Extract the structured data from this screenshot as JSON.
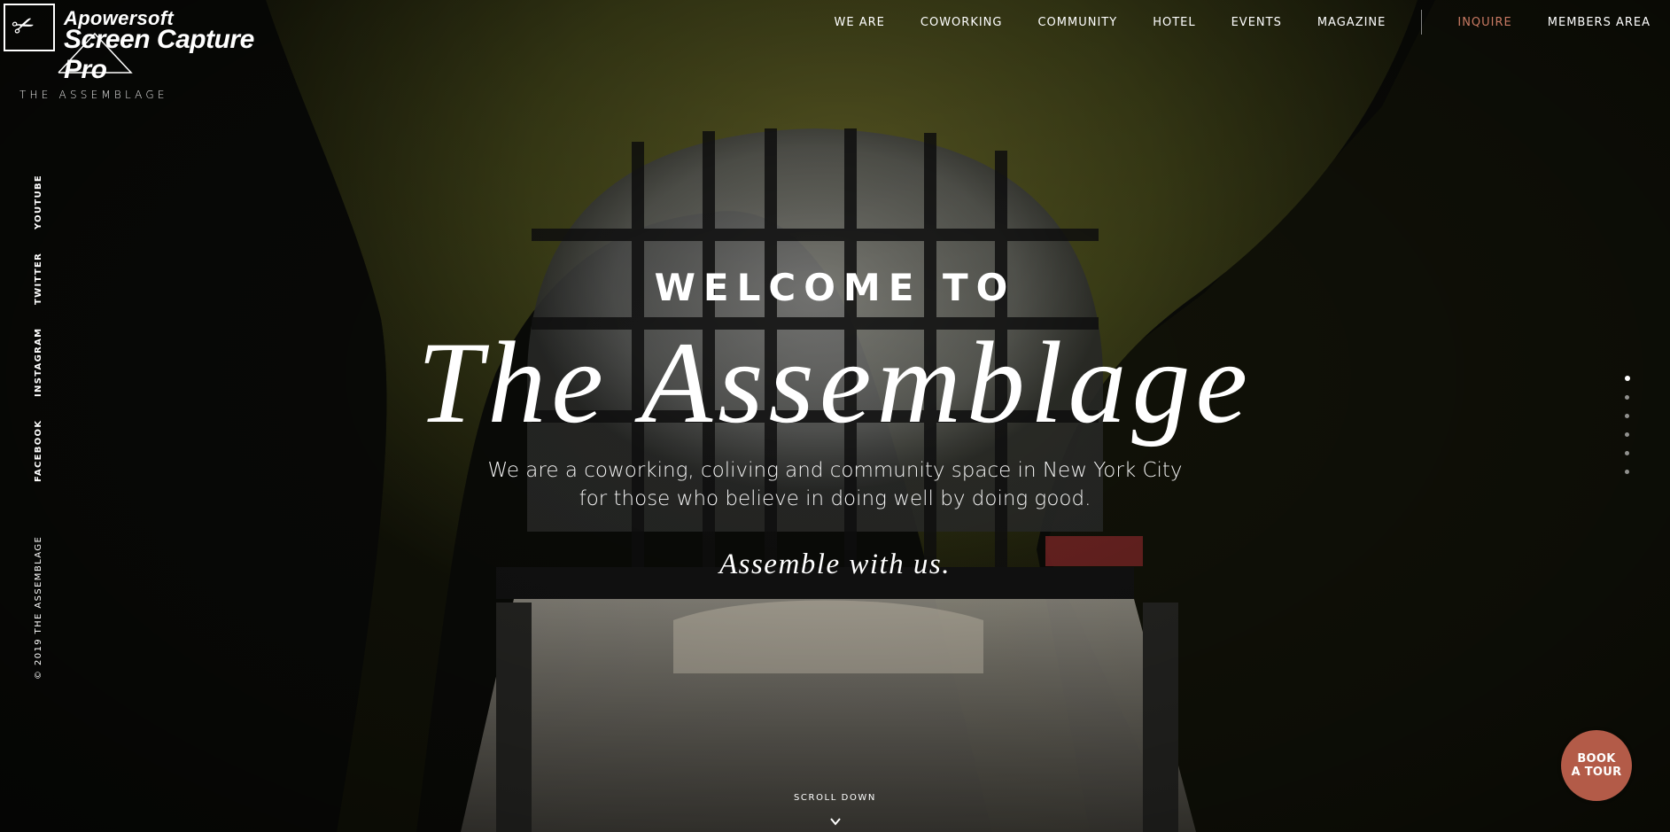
{
  "watermark": {
    "line1": "Apowersoft",
    "line2": "Screen Capture Pro",
    "icon": "scissors-icon"
  },
  "logo": {
    "text": "THE ASSEMBLAGE"
  },
  "nav": {
    "items": [
      {
        "label": "WE ARE"
      },
      {
        "label": "COWORKING"
      },
      {
        "label": "COMMUNITY"
      },
      {
        "label": "HOTEL"
      },
      {
        "label": "EVENTS"
      },
      {
        "label": "MAGAZINE"
      }
    ],
    "inquire": "INQUIRE",
    "members": "MEMBERS AREA",
    "inquire_color": "#c97a63"
  },
  "social": {
    "items": [
      {
        "label": "YOUTUBE"
      },
      {
        "label": "TWITTER"
      },
      {
        "label": "INSTAGRAM"
      },
      {
        "label": "FACEBOOK"
      }
    ],
    "copyright": "© 2019 THE ASSEMBLAGE"
  },
  "hero": {
    "welcome": "WELCOME TO",
    "brand": "The Assemblage",
    "tagline_line1": "We are a coworking, coliving and community space in New York City",
    "tagline_line2": "for those who believe in doing well by doing good.",
    "cta": "Assemble with us."
  },
  "scroll": {
    "label": "SCROLL DOWN",
    "icon": "chevron-down-icon"
  },
  "pager": {
    "count": 6,
    "active_index": 0
  },
  "book_tour": {
    "line1": "BOOK",
    "line2": "A TOUR",
    "color": "#b35b48"
  }
}
